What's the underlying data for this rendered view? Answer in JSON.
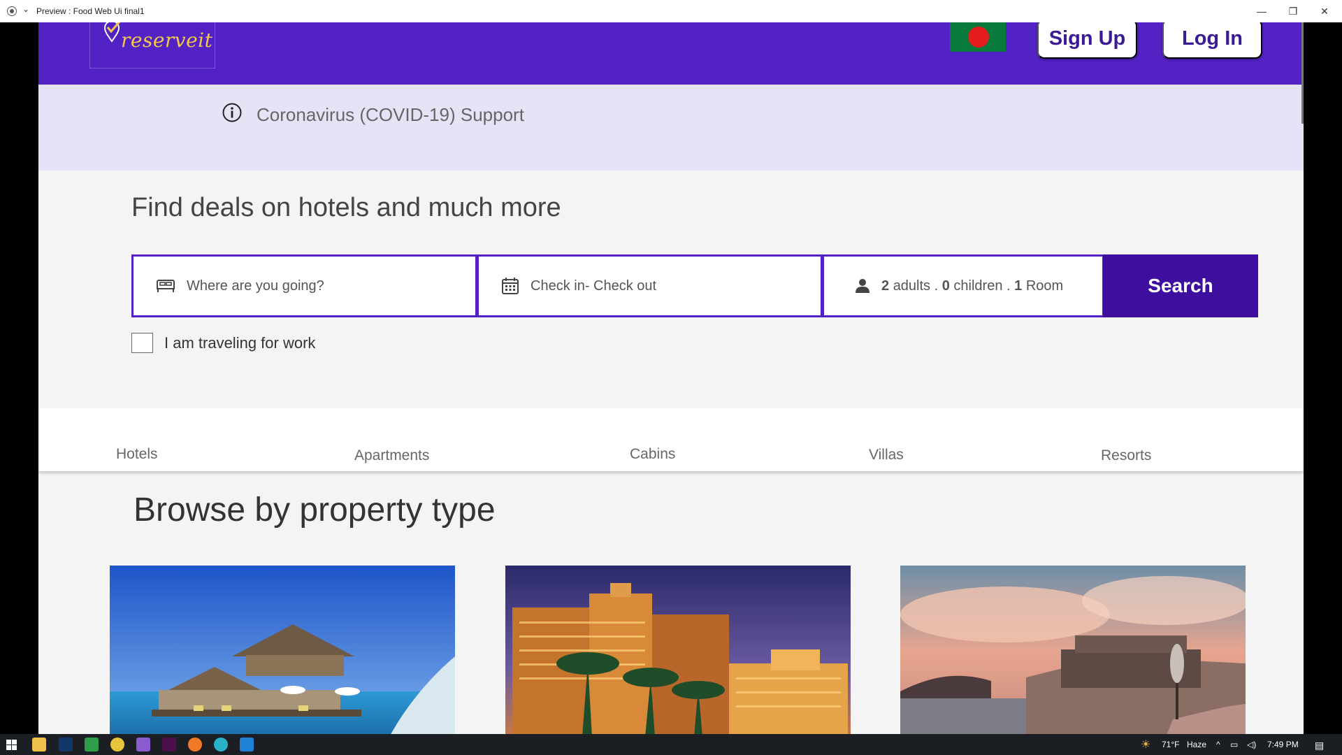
{
  "window": {
    "title": "Preview : Food Web Ui final1",
    "minimize_glyph": "—",
    "restore_glyph": "❐",
    "close_glyph": "✕"
  },
  "header": {
    "logo_text": "reserveit",
    "flag_name": "bangladesh-flag",
    "signup_label": "Sign Up",
    "login_label": "Log In",
    "brand_color": "#5222c4"
  },
  "covid": {
    "icon": "info-circle-icon",
    "text": "Coronavirus (COVID-19) Support"
  },
  "hero": {
    "title": "Find deals on hotels  and much more"
  },
  "search": {
    "destination_placeholder": "Where are you going?",
    "dates_placeholder": "Check in- Check out",
    "guests": {
      "adults_count": "2",
      "adults_label": "adults .",
      "children_count": "0",
      "children_label": "children .",
      "rooms_count": "1",
      "rooms_label": "Room"
    },
    "button_label": "Search",
    "work_label": "I am traveling for work"
  },
  "property_tabs": [
    "Hotels",
    "Apartments",
    "Cabins",
    "Villas",
    "Resorts"
  ],
  "browse": {
    "title": "Browse by property type"
  },
  "taskbar": {
    "temperature": "71°F",
    "weather": "Haze",
    "time": "7:49 PM"
  }
}
